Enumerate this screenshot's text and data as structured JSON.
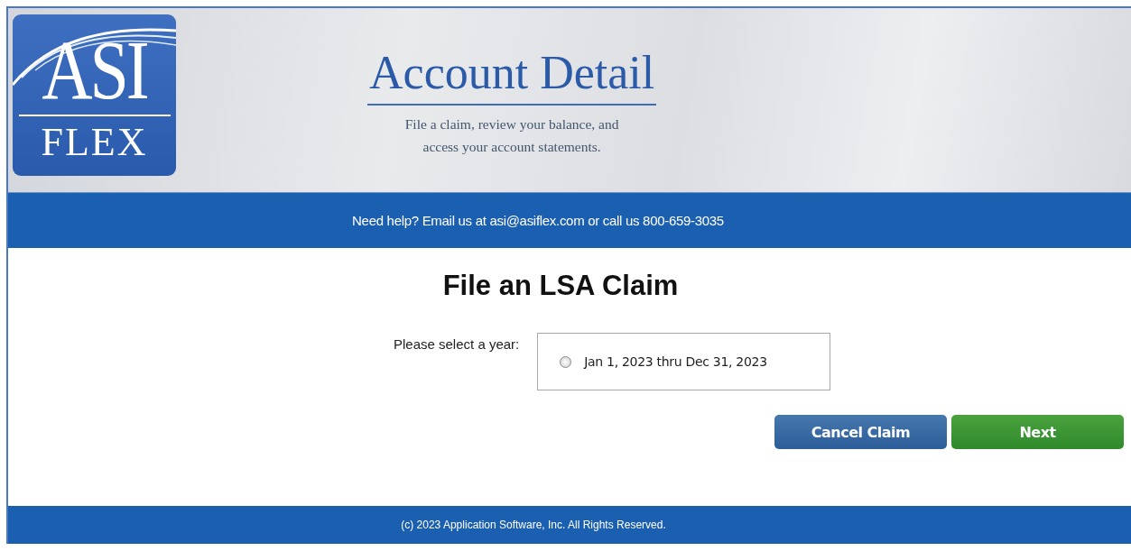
{
  "logo": {
    "top": "ASI",
    "bottom": "FLEX"
  },
  "header": {
    "title": "Account Detail",
    "subtitle_lines": [
      "File a claim, review your balance, and",
      "access your account statements."
    ]
  },
  "help_bar": {
    "text": "Need help? Email us at asi@asiflex.com or call us 800-659-3035"
  },
  "form": {
    "heading": "File an LSA Claim",
    "year_label": "Please select a year:",
    "years": [
      {
        "label": "Jan 1, 2023 thru Dec 31, 2023",
        "selected": false
      }
    ]
  },
  "buttons": [
    {
      "label": "Cancel Claim",
      "kind": "secondary"
    },
    {
      "label": "Next",
      "kind": "primary"
    }
  ],
  "footer": {
    "text": "(c) 2023 Application Software, Inc.  All Rights Reserved."
  }
}
